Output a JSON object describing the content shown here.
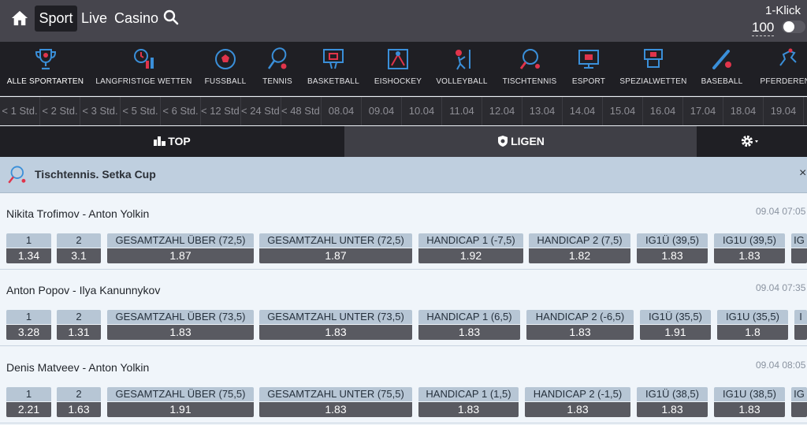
{
  "header": {
    "nav": [
      "Sport",
      "Live",
      "Casino"
    ],
    "oneklick_label": "1-Klick",
    "oneklick_amount": "100"
  },
  "sports": [
    {
      "label": "ALLE SPORTARTEN",
      "icon": "trophy-icon",
      "active": true
    },
    {
      "label": "LANGFRISTIGE WETTEN",
      "icon": "long-term-bets-icon"
    },
    {
      "label": "FUSSBALL",
      "icon": "football-icon"
    },
    {
      "label": "TENNIS",
      "icon": "tennis-icon"
    },
    {
      "label": "BASKETBALL",
      "icon": "basketball-icon"
    },
    {
      "label": "EISHOCKEY",
      "icon": "ice-hockey-icon"
    },
    {
      "label": "VOLLEYBALL",
      "icon": "volleyball-icon"
    },
    {
      "label": "TISCHTENNIS",
      "icon": "table-tennis-icon"
    },
    {
      "label": "ESPORT",
      "icon": "esport-icon"
    },
    {
      "label": "SPEZIALWETTEN",
      "icon": "special-bets-icon"
    },
    {
      "label": "BASEBALL",
      "icon": "baseball-icon"
    },
    {
      "label": "PFERDERENN",
      "icon": "horse-racing-icon"
    }
  ],
  "date_filters": [
    "< 1 Std.",
    "< 2 Std.",
    "< 3 Std.",
    "< 5 Std.",
    "< 6 Std.",
    "< 12 Std.",
    "< 24 Std.",
    "< 48 Std.",
    "08.04",
    "09.04",
    "10.04",
    "11.04",
    "12.04",
    "13.04",
    "14.04",
    "15.04",
    "16.04",
    "17.04",
    "18.04",
    "19.04"
  ],
  "tabs": {
    "top": "TOP",
    "ligen": "LIGEN"
  },
  "league": {
    "title": "Tischtennis. Setka Cup",
    "close": "×"
  },
  "matches": [
    {
      "name": "Nikita Trofimov - Anton Yolkin",
      "time": "09.04 07:05",
      "odds": [
        {
          "label": "1",
          "value": "1.34"
        },
        {
          "label": "2",
          "value": "3.1"
        },
        {
          "label": "GESAMTZAHL ÜBER (72,5)",
          "value": "1.87"
        },
        {
          "label": "GESAMTZAHL UNTER (72,5)",
          "value": "1.87"
        },
        {
          "label": "HANDICAP 1 (-7,5)",
          "value": "1.92"
        },
        {
          "label": "HANDICAP 2 (7,5)",
          "value": "1.82"
        },
        {
          "label": "IG1Ü (39,5)",
          "value": "1.83"
        },
        {
          "label": "IG1U (39,5)",
          "value": "1.83"
        },
        {
          "label": "IG",
          "value": ""
        }
      ]
    },
    {
      "name": "Anton Popov - Ilya Kanunnykov",
      "time": "09.04 07:35",
      "odds": [
        {
          "label": "1",
          "value": "3.28"
        },
        {
          "label": "2",
          "value": "1.31"
        },
        {
          "label": "GESAMTZAHL ÜBER (73,5)",
          "value": "1.83"
        },
        {
          "label": "GESAMTZAHL UNTER (73,5)",
          "value": "1.83"
        },
        {
          "label": "HANDICAP 1 (6,5)",
          "value": "1.83"
        },
        {
          "label": "HANDICAP 2 (-6,5)",
          "value": "1.83"
        },
        {
          "label": "IG1Ü (35,5)",
          "value": "1.91"
        },
        {
          "label": "IG1U (35,5)",
          "value": "1.8"
        },
        {
          "label": "I",
          "value": ""
        }
      ]
    },
    {
      "name": "Denis Matveev - Anton Yolkin",
      "time": "09.04 08:05",
      "odds": [
        {
          "label": "1",
          "value": "2.21"
        },
        {
          "label": "2",
          "value": "1.63"
        },
        {
          "label": "GESAMTZAHL ÜBER (75,5)",
          "value": "1.91"
        },
        {
          "label": "GESAMTZAHL UNTER (75,5)",
          "value": "1.83"
        },
        {
          "label": "HANDICAP 1 (1,5)",
          "value": "1.83"
        },
        {
          "label": "HANDICAP 2 (-1,5)",
          "value": "1.83"
        },
        {
          "label": "IG1Ü (38,5)",
          "value": "1.83"
        },
        {
          "label": "IG1U (38,5)",
          "value": "1.83"
        },
        {
          "label": "IG",
          "value": ""
        }
      ]
    }
  ]
}
